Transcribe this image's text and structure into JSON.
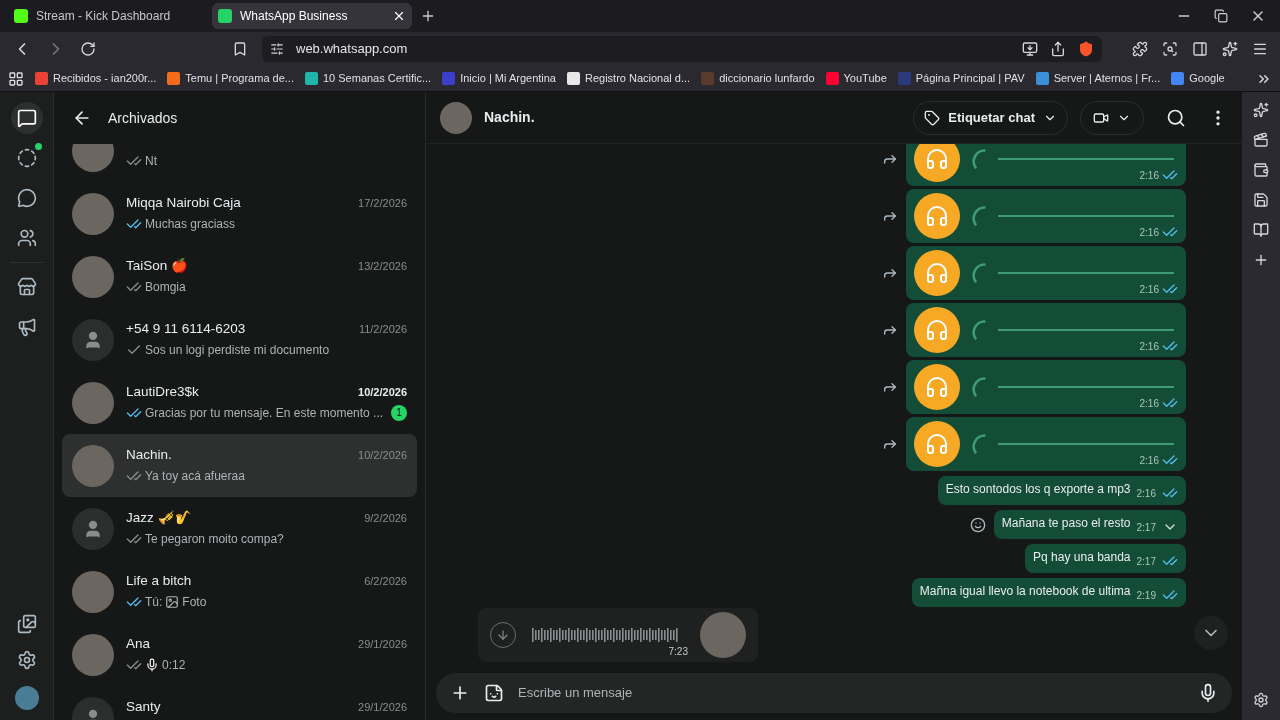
{
  "browser": {
    "tabs": [
      {
        "title": "Stream - Kick Dashboard",
        "color": "#53fc18",
        "selected": false
      },
      {
        "title": "WhatsApp Business",
        "color": "#25d366",
        "selected": true
      }
    ],
    "url": "web.whatsapp.com",
    "bookmarks": [
      {
        "label": "Recibidos - ian200r...",
        "color": "#ea4335"
      },
      {
        "label": "Temu | Programa de...",
        "color": "#f26c1c"
      },
      {
        "label": "10 Semanas Certific...",
        "color": "#1fb5a8"
      },
      {
        "label": "Inicio | Mi Argentina",
        "color": "#3b3fc9"
      },
      {
        "label": "Registro Nacional d...",
        "color": "#e8e8e8"
      },
      {
        "label": "diccionario lunfardo",
        "color": "#5a3a2a"
      },
      {
        "label": "YouTube",
        "color": "#ff0033"
      },
      {
        "label": "Página Principal | PAV",
        "color": "#2a3a7a"
      },
      {
        "label": "Server | Aternos | Fr...",
        "color": "#3a8fd9"
      },
      {
        "label": "Google",
        "color": "#4285f4"
      }
    ]
  },
  "rail": {
    "items": [
      {
        "kind": "chats",
        "selected": true,
        "dot": false
      },
      {
        "kind": "status",
        "selected": false,
        "dot": true
      },
      {
        "kind": "channels",
        "selected": false,
        "dot": false
      },
      {
        "kind": "communities",
        "selected": false,
        "dot": false
      },
      {
        "kind": "catalog",
        "selected": false,
        "dot": false
      },
      {
        "kind": "ads",
        "selected": false,
        "dot": false
      }
    ]
  },
  "chat_list": {
    "title": "Archivados",
    "chats": [
      {
        "kind": "text",
        "preview": "Nt",
        "double_tick": true,
        "read": false,
        "has_photo": true,
        "selected": false
      },
      {
        "kind": "text",
        "name": "Miqqa Nairobi Caja",
        "date": "17/2/2026",
        "preview": "Muchas graciass",
        "double_tick": true,
        "read": true,
        "has_photo": true,
        "selected": false
      },
      {
        "kind": "text",
        "name": "TaiSon 🍎",
        "date": "13/2/2026",
        "preview": "Bomgia",
        "double_tick": true,
        "read": false,
        "has_photo": true,
        "selected": false
      },
      {
        "kind": "text",
        "name": "+54 9 11 6114-6203",
        "date": "11/2/2026",
        "preview": "Sos un logi perdiste mi documento",
        "double_tick": false,
        "read": false,
        "has_photo": false,
        "selected": false
      },
      {
        "kind": "text",
        "name": "LautiDre3$k",
        "date": "10/2/2026",
        "preview": "Gracias por tu mensaje. En este momento ...",
        "double_tick": true,
        "read": true,
        "has_photo": true,
        "unread": "1",
        "selected": false
      },
      {
        "kind": "text",
        "name": "Nachin.",
        "date": "10/2/2026",
        "preview": "Ya toy acá afueraa",
        "double_tick": true,
        "read": false,
        "has_photo": true,
        "selected": true
      },
      {
        "kind": "text",
        "name": "Jazz 🎺🎷",
        "date": "9/2/2026",
        "preview": "Te pegaron moito compa?",
        "double_tick": true,
        "read": false,
        "has_photo": false,
        "selected": false
      },
      {
        "kind": "photo",
        "name": "Life a bitch",
        "date": "6/2/2026",
        "sender": "Tú:",
        "preview": "Foto",
        "double_tick": true,
        "read": true,
        "has_photo": true,
        "selected": false
      },
      {
        "kind": "voice",
        "name": "Ana",
        "date": "29/1/2026",
        "preview": "0:12",
        "double_tick": true,
        "read": false,
        "has_photo": true,
        "selected": false
      },
      {
        "kind": "none",
        "name": "Santy",
        "date": "29/1/2026",
        "has_photo": false,
        "selected": false
      }
    ]
  },
  "conversation": {
    "contact": "Nachin.",
    "label_button": "Etiquetar chat",
    "messages": [
      {
        "kind": "audio",
        "time": "2:16",
        "read": true
      },
      {
        "kind": "audio",
        "time": "2:16",
        "read": true
      },
      {
        "kind": "audio",
        "time": "2:16",
        "read": true
      },
      {
        "kind": "audio",
        "time": "2:16",
        "read": true
      },
      {
        "kind": "audio",
        "time": "2:16",
        "read": true
      },
      {
        "kind": "audio",
        "time": "2:16",
        "read": true
      },
      {
        "kind": "text",
        "text": "Esto sontodos los q exporte a mp3",
        "time": "2:16",
        "read": true,
        "hovered": false
      },
      {
        "kind": "text",
        "text": "Mañana te paso el resto",
        "time": "2:17",
        "hovered": true
      },
      {
        "kind": "text",
        "text": "Pq hay una banda",
        "time": "2:17",
        "read": true,
        "hovered": false
      },
      {
        "kind": "text",
        "text": "Mañna igual llevo la notebook de ultima",
        "time": "2:19",
        "read": true,
        "hovered": false
      }
    ],
    "voice_draft": {
      "duration": "7:23"
    },
    "composer": {
      "placeholder": "Escribe un mensaje"
    }
  }
}
